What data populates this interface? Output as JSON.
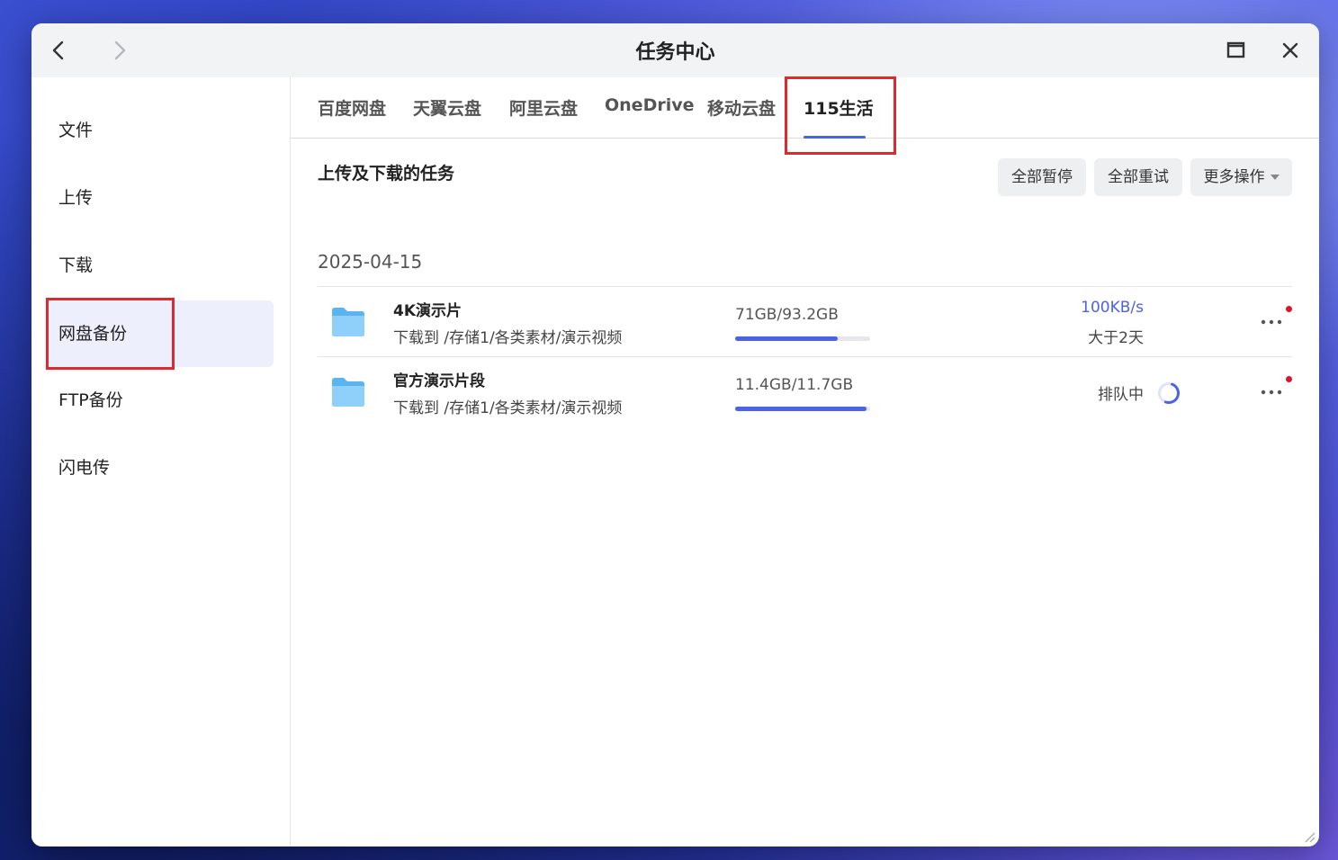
{
  "window": {
    "title": "任务中心"
  },
  "sidebar": {
    "items": [
      {
        "label": "文件"
      },
      {
        "label": "上传"
      },
      {
        "label": "下载"
      },
      {
        "label": "网盘备份"
      },
      {
        "label": "FTP备份"
      },
      {
        "label": "闪电传"
      }
    ],
    "active_index": 3
  },
  "tabs": [
    {
      "label": "百度网盘"
    },
    {
      "label": "天翼云盘"
    },
    {
      "label": "阿里云盘"
    },
    {
      "label": "OneDrive"
    },
    {
      "label": "移动云盘"
    },
    {
      "label": "115生活"
    }
  ],
  "active_tab_index": 5,
  "section": {
    "title": "上传及下载的任务",
    "pause_all": "全部暂停",
    "retry_all": "全部重试",
    "more_actions": "更多操作"
  },
  "date_group": "2025-04-15",
  "tasks": [
    {
      "name": "4K演示片",
      "path": "下载到 /存储1/各类素材/演示视频",
      "size": "71GB/93.2GB",
      "progress": 0.76,
      "speed": "100KB/s",
      "eta": "大于2天",
      "status": ""
    },
    {
      "name": "官方演示片段",
      "path": "下载到 /存储1/各类素材/演示视频",
      "size": "11.4GB/11.7GB",
      "progress": 0.974,
      "speed": "",
      "eta": "",
      "status": "排队中"
    }
  ],
  "colors": {
    "accent": "#4a63e7",
    "highlight_border": "#e0282f",
    "notification_dot": "#d9162b",
    "folder": "#5ab4f0"
  },
  "icons": {
    "back": "chevron-left-icon",
    "forward": "chevron-right-icon",
    "maximize": "maximize-icon",
    "close": "close-icon",
    "folder": "folder-icon",
    "more": "more-horizontal-icon",
    "spinner": "loading-spinner-icon"
  }
}
